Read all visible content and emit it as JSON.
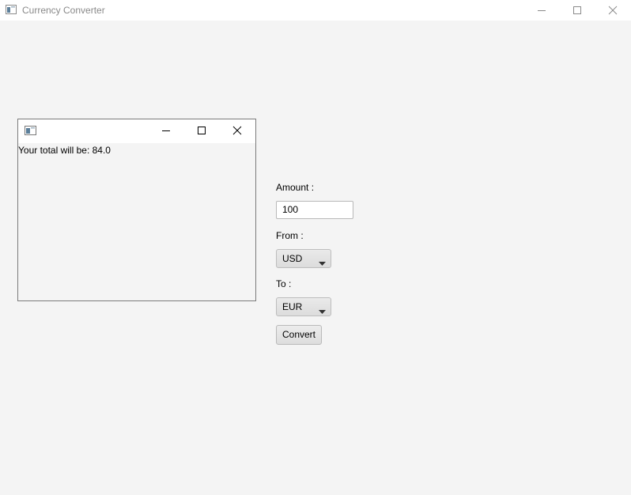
{
  "window": {
    "title": "Currency Converter",
    "controls": [
      "minimize-icon",
      "maximize-icon",
      "close-icon"
    ]
  },
  "dialog": {
    "title": "",
    "result_text": "Your total will be: 84.0",
    "controls": [
      "minimize-icon",
      "maximize-icon",
      "close-icon"
    ]
  },
  "form": {
    "amount_label": "Amount :",
    "amount_value": "100",
    "from_label": "From :",
    "from_value": "USD",
    "to_label": "To :",
    "to_value": "EUR",
    "convert_label": "Convert"
  },
  "colors": {
    "background": "#f4f4f4",
    "titlebar": "#ffffff",
    "title_text": "#8a8a8a"
  }
}
